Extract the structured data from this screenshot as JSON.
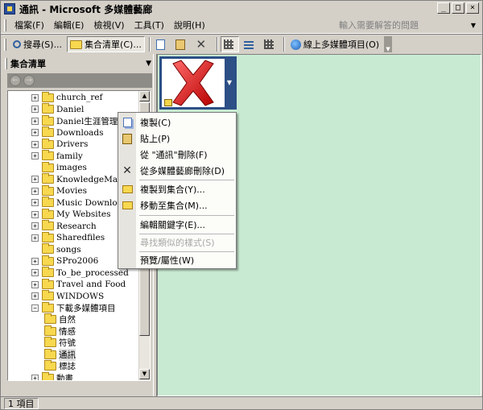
{
  "window": {
    "title": "通訊 - Microsoft 多媒體藝廊",
    "min": "_",
    "max": "□",
    "close": "×"
  },
  "menu": [
    "檔案(F)",
    "編輯(E)",
    "檢視(V)",
    "工具(T)",
    "說明(H)"
  ],
  "help_box": {
    "placeholder": "輸入需要解答的問題"
  },
  "toolbar": {
    "search": "搜尋(S)...",
    "collection_list": "集合清單(C)...",
    "online_media": "線上多媒體項目(O)"
  },
  "left_pane": {
    "title": "集合清單",
    "tree": [
      {
        "label": "church_ref",
        "expand": "+",
        "level": 0
      },
      {
        "label": "Daniel",
        "expand": "+",
        "level": 0
      },
      {
        "label": "Daniel生涯管理與",
        "expand": "+",
        "level": 0
      },
      {
        "label": "Downloads",
        "expand": "+",
        "level": 0
      },
      {
        "label": "Drivers",
        "expand": "+",
        "level": 0
      },
      {
        "label": "family",
        "expand": "+",
        "level": 0
      },
      {
        "label": "images",
        "expand": "",
        "level": 0
      },
      {
        "label": "KnowledgeManag",
        "expand": "+",
        "level": 0
      },
      {
        "label": "Movies",
        "expand": "+",
        "level": 0
      },
      {
        "label": "Music Download",
        "expand": "+",
        "level": 0
      },
      {
        "label": "My Websites",
        "expand": "+",
        "level": 0
      },
      {
        "label": "Research",
        "expand": "+",
        "level": 0
      },
      {
        "label": "Sharedfiles",
        "expand": "+",
        "level": 0
      },
      {
        "label": "songs",
        "expand": "",
        "level": 0
      },
      {
        "label": "SPro2006",
        "expand": "+",
        "level": 0
      },
      {
        "label": "To_be_processed",
        "expand": "+",
        "level": 0
      },
      {
        "label": "Travel and Food",
        "expand": "+",
        "level": 0
      },
      {
        "label": "WINDOWS",
        "expand": "+",
        "level": 0
      },
      {
        "label": "下載多媒體項目",
        "expand": "−",
        "level": 0
      },
      {
        "label": "自然",
        "expand": "",
        "level": 1
      },
      {
        "label": "情感",
        "expand": "",
        "level": 1
      },
      {
        "label": "符號",
        "expand": "",
        "level": 1
      },
      {
        "label": "通訊",
        "expand": "",
        "level": 1,
        "selected": true
      },
      {
        "label": "標誌",
        "expand": "",
        "level": 1
      },
      {
        "label": "動畫",
        "expand": "+",
        "level": 0
      }
    ]
  },
  "context_menu": [
    {
      "label": "複製(C)",
      "icon": "copy-icon",
      "disabled": false
    },
    {
      "label": "貼上(P)",
      "icon": "paste-icon",
      "disabled": false
    },
    {
      "label": "從 \"通訊\"刪除(F)",
      "icon": "",
      "disabled": false
    },
    {
      "label": "從多媒體藝廊刪除(D)",
      "icon": "delete-icon",
      "disabled": false
    },
    {
      "label": "複製到集合(Y)...",
      "icon": "copy-to-collection-icon",
      "disabled": false
    },
    {
      "label": "移動至集合(M)...",
      "icon": "move-to-collection-icon",
      "disabled": false
    },
    {
      "label": "編輯關鍵字(E)...",
      "icon": "",
      "disabled": false
    },
    {
      "label": "尋找類似的樣式(S)",
      "icon": "",
      "disabled": true
    },
    {
      "label": "預覽/屬性(W)",
      "icon": "",
      "disabled": false
    }
  ],
  "status": {
    "items": "1 項目"
  }
}
